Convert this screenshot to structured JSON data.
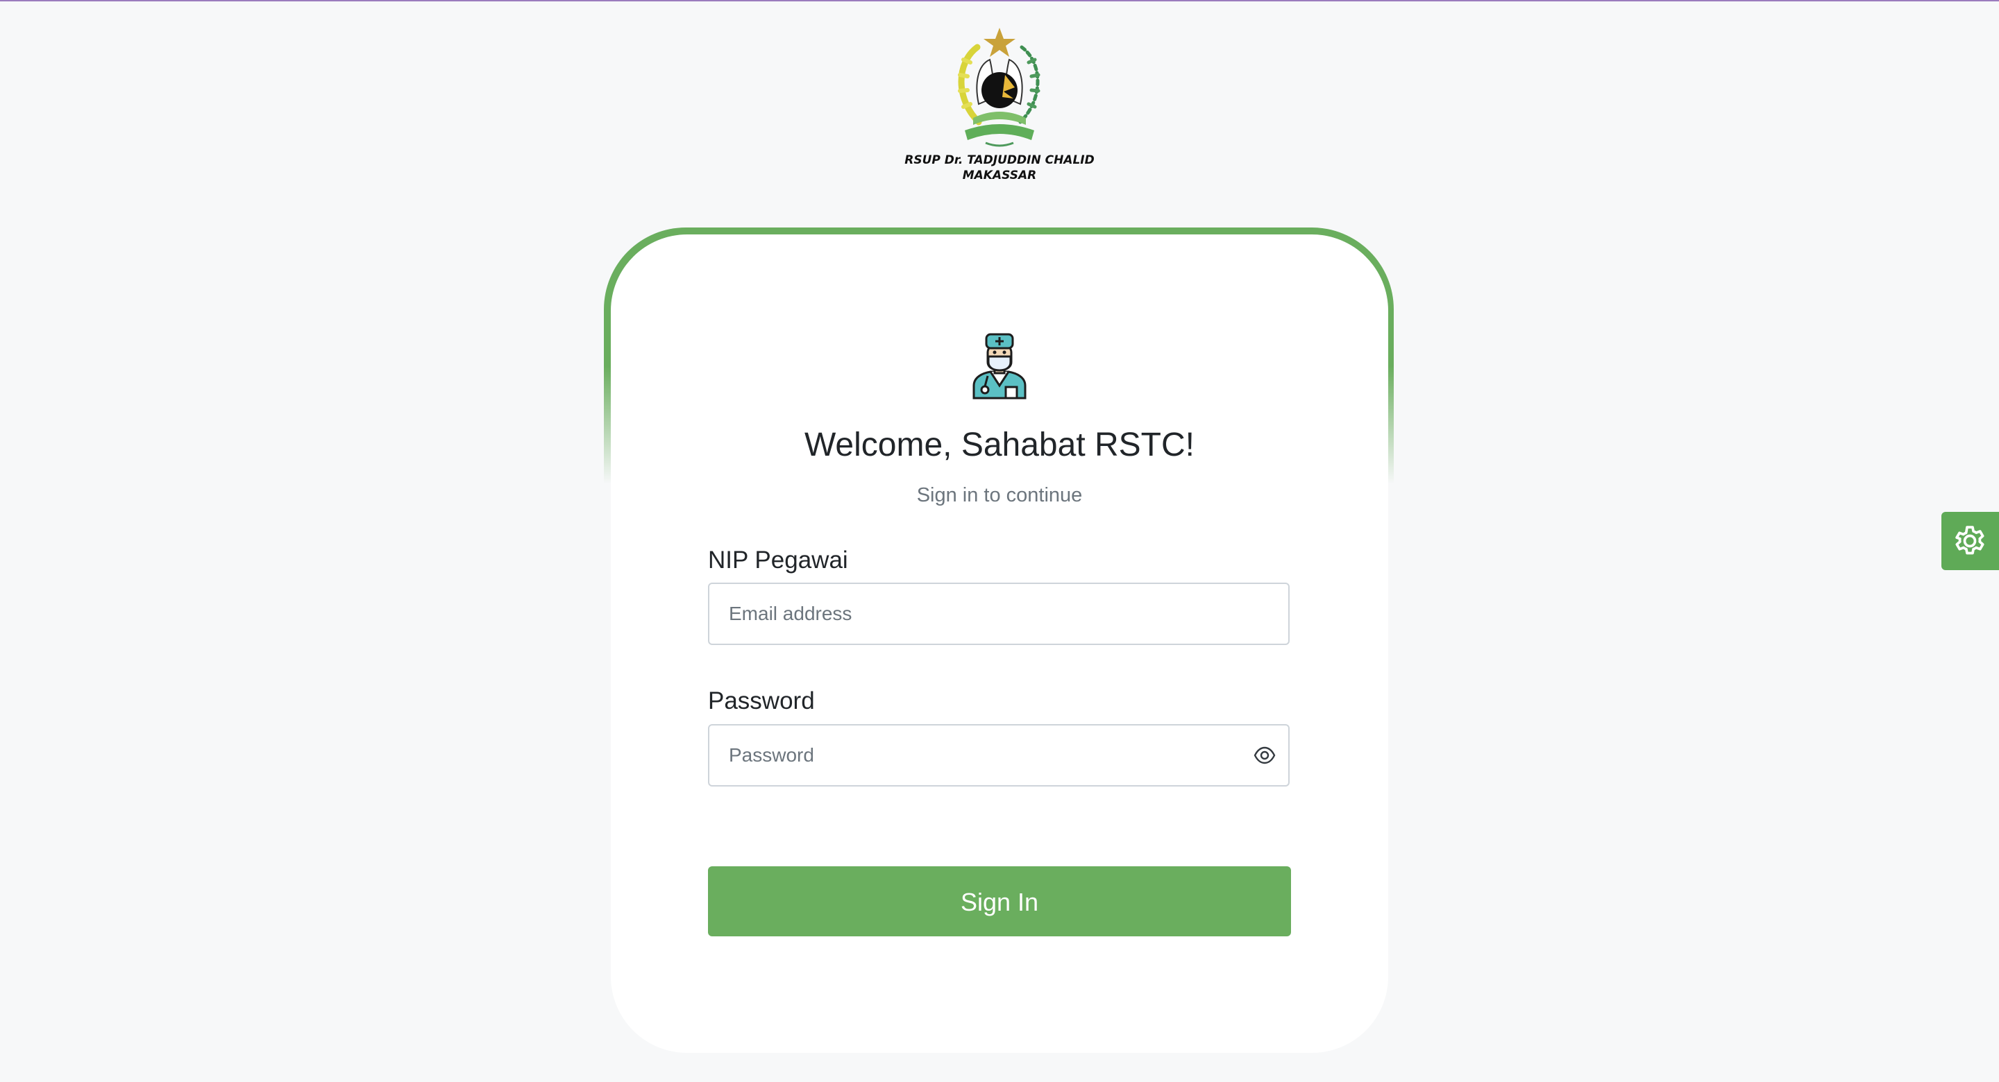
{
  "colors": {
    "accent": "#6aae5e",
    "settings_tab": "#5faa57",
    "top_strip": "#9b7bbd",
    "background": "#f7f8f9"
  },
  "header": {
    "logo_icon": "hospital-logo-icon",
    "logo_text": "RSUP Dr. TADJUDDIN CHALID MAKASSAR",
    "logo_caption_line1": "RSUP Dr. TADJUDDIN CHALID",
    "logo_caption_line2": "MAKASSAR"
  },
  "login": {
    "avatar_icon": "doctor-avatar-icon",
    "title": "Welcome, Sahabat RSTC!",
    "subtitle": "Sign in to continue",
    "nip_label": "NIP Pegawai",
    "nip_placeholder": "Email address",
    "nip_value": "",
    "password_label": "Password",
    "password_placeholder": "Password",
    "password_value": "",
    "password_toggle_icon": "eye-icon",
    "submit_label": "Sign In"
  },
  "settings": {
    "icon": "gear-icon"
  }
}
